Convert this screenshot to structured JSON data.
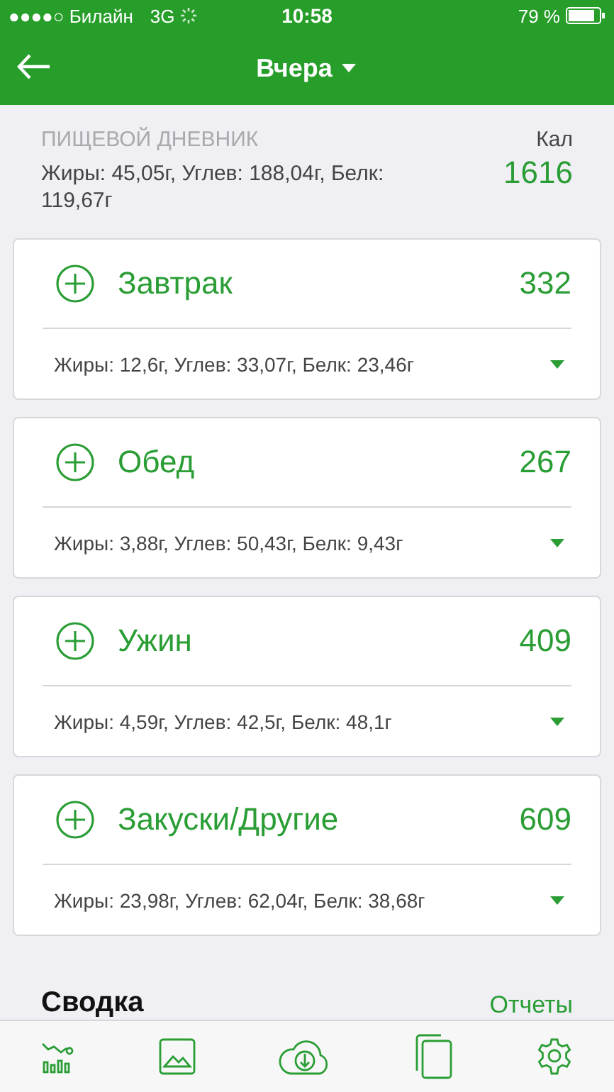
{
  "status_bar": {
    "carrier": "●●●●○ Билайн",
    "network": "3G",
    "time": "10:58",
    "battery": "79 %"
  },
  "header": {
    "title": "Вчера"
  },
  "diary": {
    "label": "ПИЩЕВОЙ ДНЕВНИК",
    "macros": "Жиры: 45,05г, Углев: 188,04г, Белк: 119,67г",
    "cal_label": "Кал",
    "cal_value": "1616"
  },
  "meals": [
    {
      "name": "Завтрак",
      "calories": "332",
      "macros": "Жиры: 12,6г, Углев: 33,07г, Белк: 23,46г"
    },
    {
      "name": "Обед",
      "calories": "267",
      "macros": "Жиры: 3,88г, Углев: 50,43г, Белк: 9,43г"
    },
    {
      "name": "Ужин",
      "calories": "409",
      "macros": "Жиры: 4,59г, Углев: 42,5г, Белк: 48,1г"
    },
    {
      "name": "Закуски/Другие",
      "calories": "609",
      "macros": "Жиры: 23,98г, Углев: 62,04г, Белк: 38,68г"
    }
  ],
  "summary": {
    "title": "Сводка",
    "link": "Отчеты"
  }
}
